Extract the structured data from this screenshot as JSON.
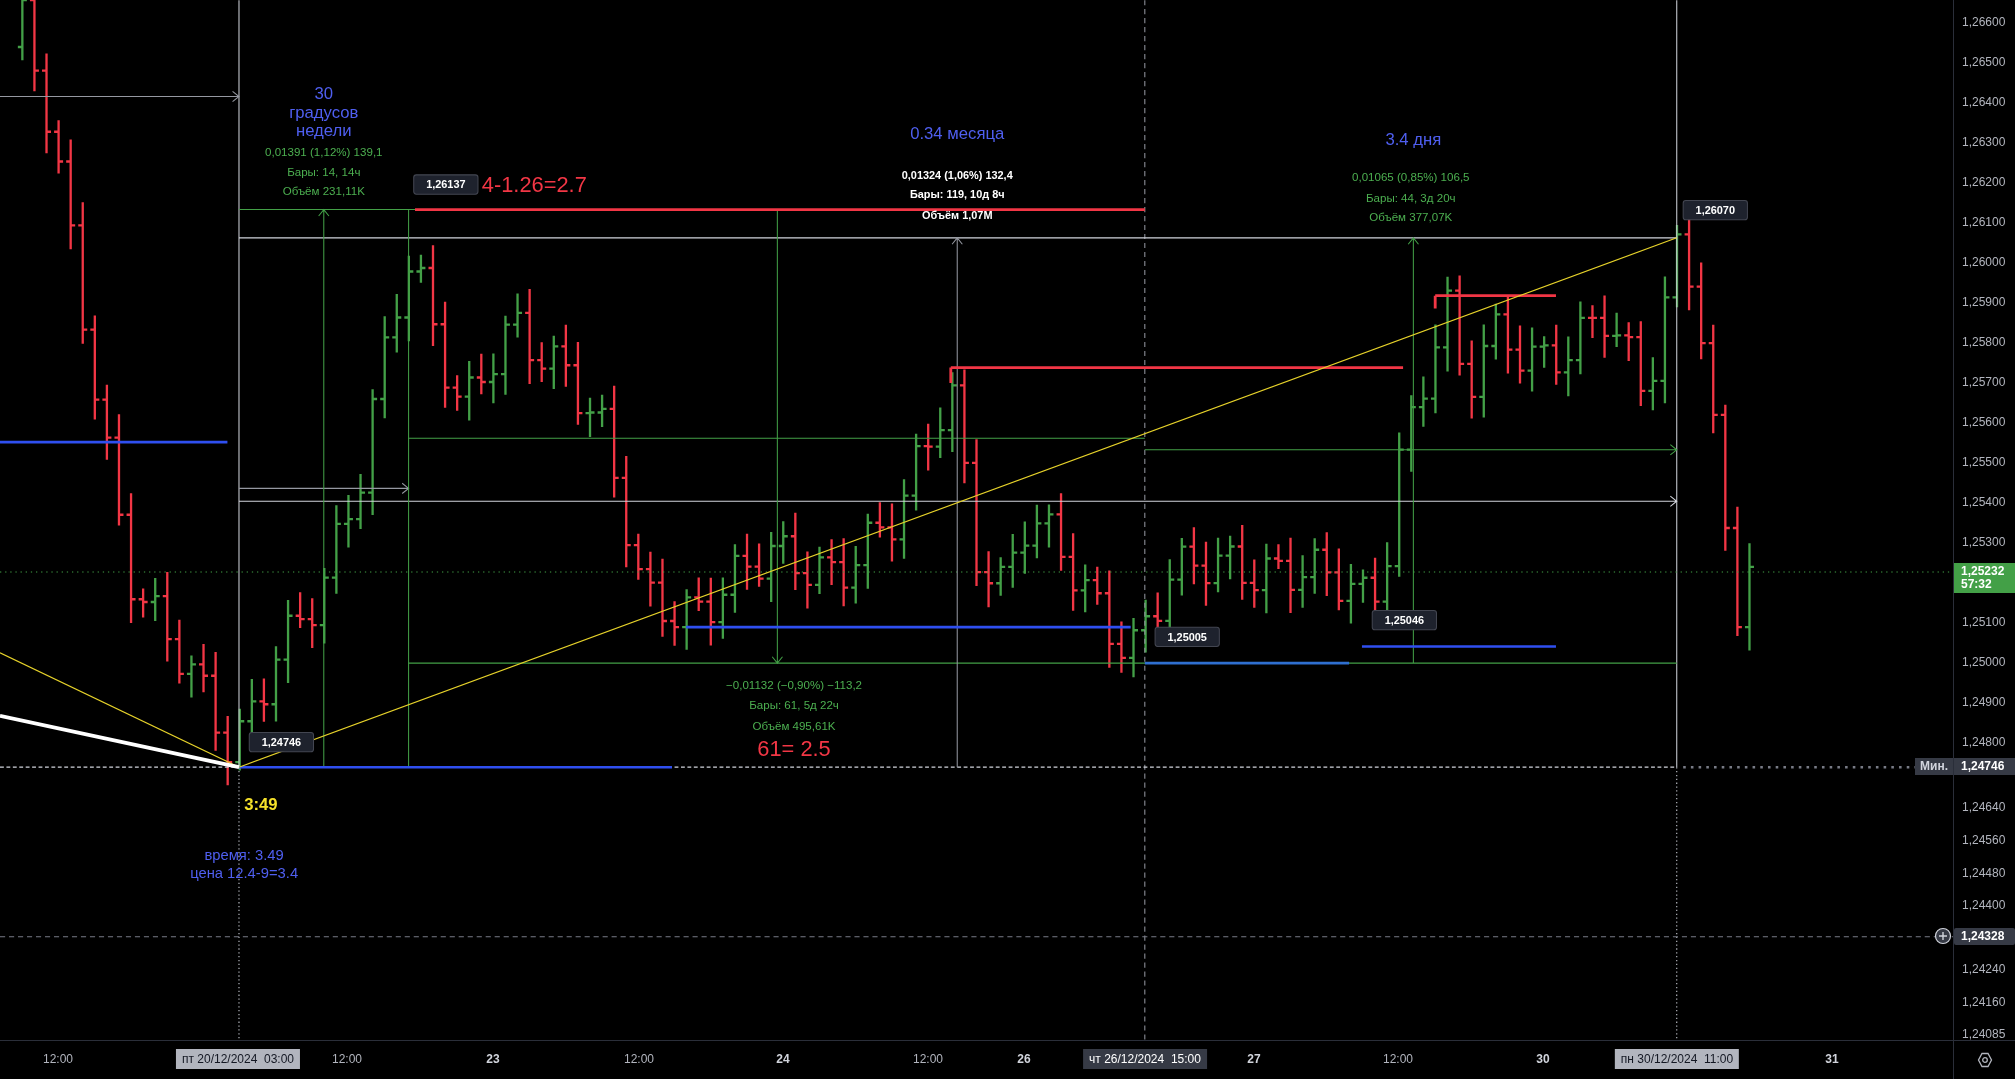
{
  "chart": {
    "annotations": [
      {
        "text": "30",
        "color": "#4f5ff0"
      },
      {
        "text": "градусов",
        "color": "#4f5ff0"
      },
      {
        "text": "недели",
        "color": "#4f5ff0"
      },
      {
        "text": "0,01391 (1,12%) 139,1",
        "color": "#4caf50"
      },
      {
        "text": "Бары: 14, 14ч",
        "color": "#4caf50"
      },
      {
        "text": "Объём 231,11K",
        "color": "#4caf50"
      },
      {
        "text": "4-1.26=2.7",
        "color": "#f23645"
      },
      {
        "text": "0.34 месяца",
        "color": "#4f5ff0"
      },
      {
        "text": "0,01324 (1,06%) 132,4",
        "color": "#ffffff"
      },
      {
        "text": "Бары: 119, 10д 8ч",
        "color": "#ffffff"
      },
      {
        "text": "Объём 1,07M",
        "color": "#ffffff"
      },
      {
        "text": "3.4 дня",
        "color": "#4f5ff0"
      },
      {
        "text": "0,01065 (0,85%) 106,5",
        "color": "#4caf50"
      },
      {
        "text": "Бары: 44, 3д 20ч",
        "color": "#4caf50"
      },
      {
        "text": "Объём 377,07K",
        "color": "#4caf50"
      },
      {
        "text": "−0,01132 (−0,90%) −113,2",
        "color": "#4caf50"
      },
      {
        "text": "Бары: 61, 5д 22ч",
        "color": "#4caf50"
      },
      {
        "text": "Объём 495,61K",
        "color": "#4caf50"
      },
      {
        "text": "61= 2.5",
        "color": "#f23645"
      },
      {
        "text": "3:49",
        "color": "#f5e12a"
      },
      {
        "text": "время: 3.49",
        "color": "#4f5ff0"
      },
      {
        "text": "цена 12.4-9=3.4",
        "color": "#4f5ff0"
      }
    ],
    "price_callouts": [
      "1,26137",
      "1,24746",
      "1,25005",
      "1,25046",
      "1,26070"
    ]
  },
  "price_axis": {
    "ticks": [
      "1,26600",
      "1,26500",
      "1,26400",
      "1,26300",
      "1,26200",
      "1,26100",
      "1,26000",
      "1,25900",
      "1,25800",
      "1,25700",
      "1,25600",
      "1,25500",
      "1,25400",
      "1,25300",
      "1,25100",
      "1,25000",
      "1,24900",
      "1,24800",
      "1,24640",
      "1,24560",
      "1,24480",
      "1,24400",
      "1,24240",
      "1,24160",
      "1,24085"
    ],
    "current_price": {
      "price": "1,25232",
      "countdown": "57:32"
    },
    "minimum": {
      "label": "Мин.",
      "price": "1,24746"
    },
    "crosshair": {
      "price": "1,24328"
    }
  },
  "time_axis": {
    "labels": [
      {
        "text": "12:00",
        "kind": "time"
      },
      {
        "text": "пт 20/12/2024  03:00",
        "kind": "range"
      },
      {
        "text": "12:00",
        "kind": "time"
      },
      {
        "text": "23",
        "kind": "day"
      },
      {
        "text": "12:00",
        "kind": "time"
      },
      {
        "text": "24",
        "kind": "day"
      },
      {
        "text": "12:00",
        "kind": "time"
      },
      {
        "text": "26",
        "kind": "day"
      },
      {
        "text": "чт 26/12/2024  15:00",
        "kind": "cursor"
      },
      {
        "text": "27",
        "kind": "day"
      },
      {
        "text": "12:00",
        "kind": "time"
      },
      {
        "text": "30",
        "kind": "day"
      },
      {
        "text": "пн 30/12/2024  11:00",
        "kind": "range"
      },
      {
        "text": "31",
        "kind": "day"
      }
    ]
  }
}
